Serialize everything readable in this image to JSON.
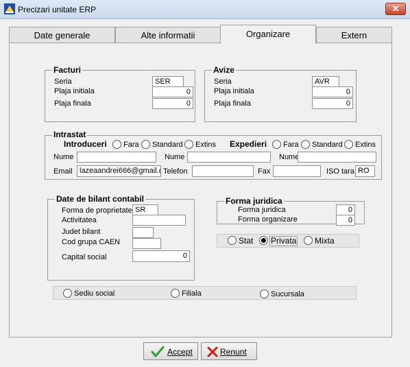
{
  "window": {
    "title": "Precizari unitate ERP",
    "close_label": "✕"
  },
  "tabs": [
    {
      "label": "Date generale"
    },
    {
      "label": "Alte informatii"
    },
    {
      "label": "Organizare",
      "active": true
    },
    {
      "label": "Extern"
    }
  ],
  "facturi": {
    "title": "Facturi",
    "seria_label": "Seria",
    "seria_value": "SER",
    "plaja_initiala_label": "Plaja  initiala",
    "plaja_initiala_value": "0",
    "plaja_finala_label": "Plaja  finala",
    "plaja_finala_value": "0"
  },
  "avize": {
    "title": "Avize",
    "seria_label": "Seria",
    "seria_value": "AVR",
    "plaja_initiala_label": "Plaja  initiala",
    "plaja_initiala_value": "0",
    "plaja_finala_label": "Plaja  finala",
    "plaja_finala_value": "0"
  },
  "intrastat": {
    "title": "Intrastat",
    "introduceri_label": "Introduceri",
    "expedieri_label": "Expedieri",
    "introduceri_options": [
      {
        "label": "Fara"
      },
      {
        "label": "Standard"
      },
      {
        "label": "Extins"
      }
    ],
    "expedieri_options": [
      {
        "label": "Fara"
      },
      {
        "label": "Standard"
      },
      {
        "label": "Extins"
      }
    ],
    "nume_label": "Nume",
    "nume1_value": "",
    "nume2_value": "",
    "nume3_value": "",
    "email_label": "Email",
    "email_value": "lazeaandrei666@gmail.c",
    "telefon_label": "Telefon",
    "telefon_value": "",
    "fax_label": "Fax",
    "fax_value": "",
    "iso_label": "ISO tara",
    "iso_value": "RO"
  },
  "bilant": {
    "title": "Date de bilant contabil",
    "forma_proprietate_label": "Forma de proprietate",
    "forma_proprietate_value": "SR",
    "activitatea_label": "Activitatea",
    "activitatea_value": "",
    "judet_label": "Judet bilant",
    "judet_value": "",
    "caen_label": "Cod grupa CAEN",
    "caen_value": "",
    "capital_label": "Capital social",
    "capital_value": "0"
  },
  "forma_juridica": {
    "title": "Forma juridica",
    "juridica_label": "Forma juridica",
    "juridica_value": "0",
    "organizare_label": "Forma organizare",
    "organizare_value": "0"
  },
  "tip_proprietate": {
    "options": [
      {
        "label": "Stat"
      },
      {
        "label": "Privata"
      },
      {
        "label": "Mixta"
      }
    ],
    "selected": "Privata"
  },
  "sediu": {
    "options": [
      {
        "label": "Sediu social"
      },
      {
        "label": "Filiala"
      },
      {
        "label": "Sucursala"
      }
    ]
  },
  "buttons": {
    "accept": "Accept",
    "renunt": "Renunt"
  },
  "colors": {
    "accept_check": "#2e9e2e",
    "renunt_x": "#d02010"
  }
}
